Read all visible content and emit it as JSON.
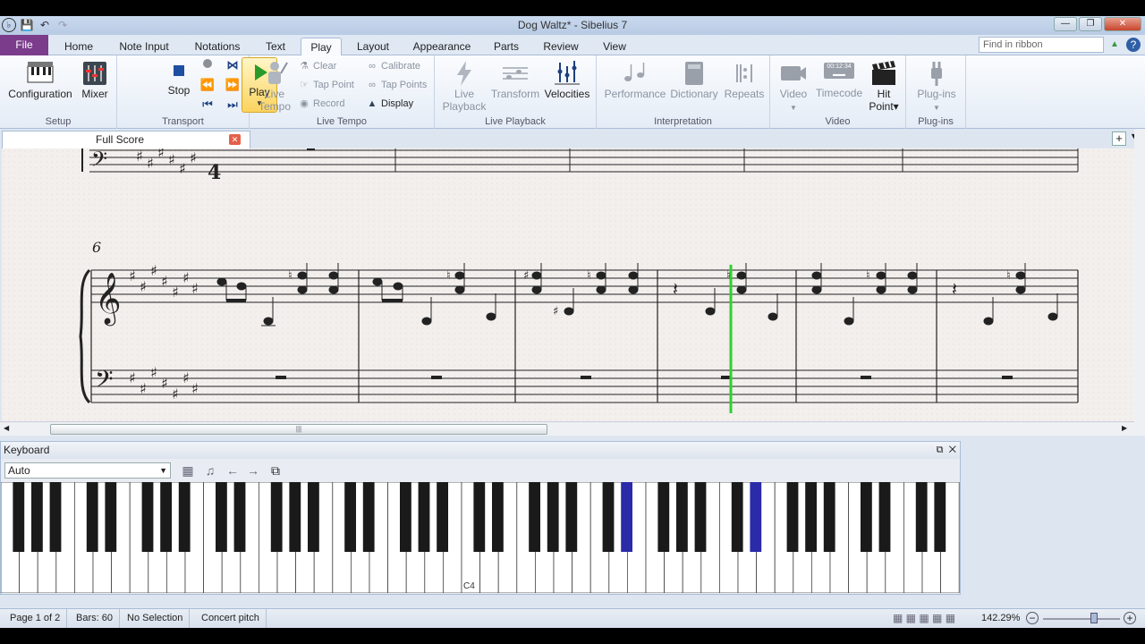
{
  "window": {
    "title": "Dog Waltz* - Sibelius 7"
  },
  "tabs": [
    "File",
    "Home",
    "Note Input",
    "Notations",
    "Text",
    "Play",
    "Layout",
    "Appearance",
    "Parts",
    "Review",
    "View"
  ],
  "find": {
    "placeholder": "Find in ribbon"
  },
  "ribbon": {
    "setup": {
      "label": "Setup",
      "configuration": "Configuration",
      "mixer": "Mixer"
    },
    "transport": {
      "label": "Transport",
      "play": "Play",
      "stop": "Stop"
    },
    "live_tempo": {
      "label": "Live Tempo",
      "live_tempo_btn": "Live Tempo",
      "clear": "Clear",
      "tap_point": "Tap Point",
      "record": "Record",
      "calibrate": "Calibrate",
      "tap_points": "Tap Points",
      "display": "Display"
    },
    "live_playback": {
      "label": "Live Playback",
      "live_playback_btn": "Live Playback",
      "transform": "Transform",
      "velocities": "Velocities"
    },
    "interpretation": {
      "label": "Interpretation",
      "performance": "Performance",
      "dictionary": "Dictionary",
      "repeats": "Repeats"
    },
    "video": {
      "label": "Video",
      "video_btn": "Video",
      "timecode": "Timecode",
      "timecode_display": "00:12:34",
      "hit_point": "Hit Point"
    },
    "plugins": {
      "label": "Plug-ins",
      "plugins_btn": "Plug-ins"
    }
  },
  "document": {
    "tab": "Full Score"
  },
  "score": {
    "measure_number": "6",
    "time_sig_top": "4"
  },
  "keyboard": {
    "title": "Keyboard",
    "mode": "Auto",
    "c4_label": "C4",
    "highlighted_keys": [
      "black key 24",
      "black key 29"
    ],
    "highlight_color": "#2b2aa8"
  },
  "status": {
    "page": "Page 1 of 2",
    "bars": "Bars: 60",
    "selection": "No Selection",
    "pitch": "Concert pitch",
    "zoom": "142.29%"
  },
  "colors": {
    "file_tab": "#7b3c8c",
    "playback_line": "#2fd02f"
  }
}
